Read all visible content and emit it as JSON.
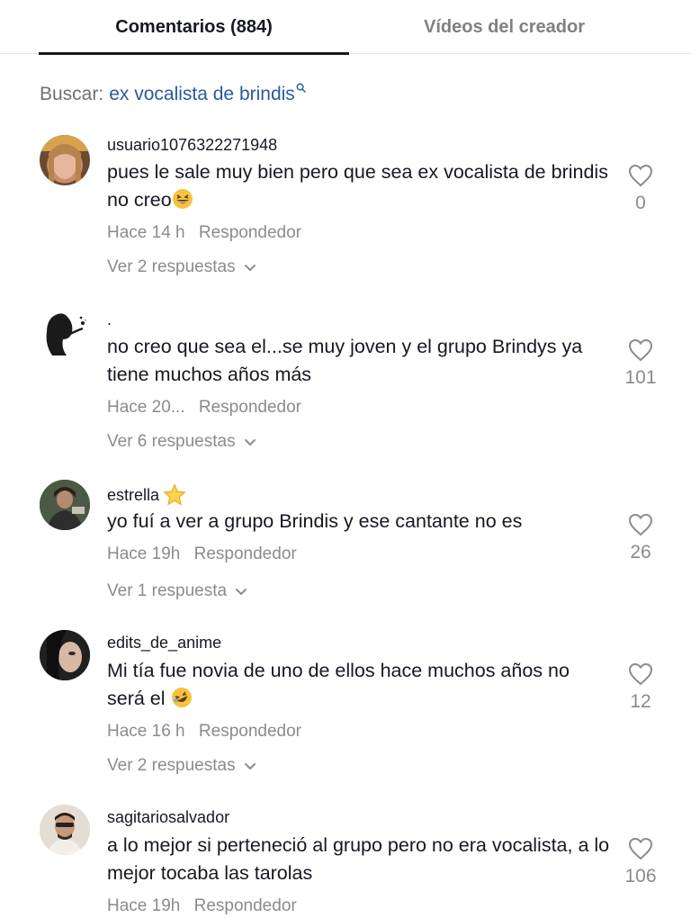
{
  "tabs": {
    "comments": "Comentarios (884)",
    "videos": "Vídeos del creador"
  },
  "search": {
    "label": "Buscar:",
    "query": "ex vocalista de brindis"
  },
  "comments": [
    {
      "username": "usuario1076322271948",
      "text": "pues le sale muy bien pero que sea ex vocalista de brindis no creo",
      "emoji": "grinning-squinting-face",
      "time": "Hace 14 h",
      "reply": "Respondedor",
      "replies": "Ver 2 respuestas",
      "likes": "0"
    },
    {
      "username": ".",
      "text": "no creo que sea el...se muy joven y el grupo Brindys ya tiene muchos años más",
      "time": "Hace 20...",
      "reply": "Respondedor",
      "replies": "Ver 6 respuestas",
      "likes": "101"
    },
    {
      "username": "estrella",
      "badge": "star",
      "text": "yo fuí a ver a grupo Brindis y ese cantante no es",
      "time": "Hace 19h",
      "reply": "Respondedor",
      "replies": "Ver 1 respuesta",
      "likes": "26"
    },
    {
      "username": "edits_de_anime",
      "text": "Mi tía fue novia de uno de ellos hace muchos años no será el",
      "emoji": "rolling-on-floor-laughing",
      "time": "Hace 16 h",
      "reply": "Respondedor",
      "replies": "Ver 2 respuestas",
      "likes": "12"
    },
    {
      "username": "sagitariosalvador",
      "text": "a lo mejor si perteneció al grupo pero no era vocalista, a lo mejor tocaba las tarolas",
      "time": "Hace 19h",
      "reply": "Respondedor",
      "likes": "106"
    }
  ]
}
